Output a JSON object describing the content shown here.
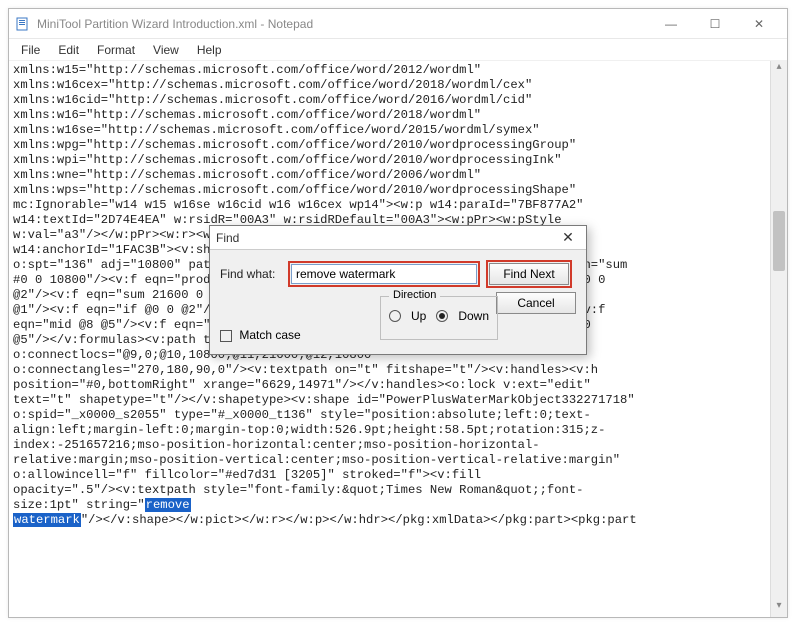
{
  "window": {
    "title": "MiniTool Partition Wizard Introduction.xml - Notepad"
  },
  "menu": {
    "file": "File",
    "edit": "Edit",
    "format": "Format",
    "view": "View",
    "help": "Help"
  },
  "find": {
    "title": "Find",
    "label": "Find what:",
    "value": "remove watermark",
    "find_next": "Find Next",
    "cancel": "Cancel",
    "match_case": "Match case",
    "direction_legend": "Direction",
    "up": "Up",
    "down": "Down",
    "direction_selected": "down"
  },
  "editor": {
    "pre_highlight": "xmlns:w15=\"http://schemas.microsoft.com/office/word/2012/wordml\"\nxmlns:w16cex=\"http://schemas.microsoft.com/office/word/2018/wordml/cex\"\nxmlns:w16cid=\"http://schemas.microsoft.com/office/word/2016/wordml/cid\"\nxmlns:w16=\"http://schemas.microsoft.com/office/word/2018/wordml\"\nxmlns:w16se=\"http://schemas.microsoft.com/office/word/2015/wordml/symex\"\nxmlns:wpg=\"http://schemas.microsoft.com/office/word/2010/wordprocessingGroup\"\nxmlns:wpi=\"http://schemas.microsoft.com/office/word/2010/wordprocessingInk\"\nxmlns:wne=\"http://schemas.microsoft.com/office/word/2006/wordml\"\nxmlns:wps=\"http://schemas.microsoft.com/office/word/2010/wordprocessingShape\"\nmc:Ignorable=\"w14 w15 w16se w16cid w16 w16cex wp14\"><w:p w14:paraId=\"7BF877A2\"\nw14:textId=\"2D74E4EA\" w:rsidR=\"00A3\" w:rsidRDefault=\"00A3\"><w:pPr><w:pStyle\nw:val=\"a3\"/></w:pPr><w:r><w:rPr><w:noProof/></w:rPr><w:pict\nw14:anchorId=\"1FAC3B\"><v:shapetype id=\"_x0000_t136\" coordsize=\"21600, 21600\"\no:spt=\"136\" adj=\"10800\" path=\"m@7,l@8,m@5,21600l@6,21600e\"><v:formulas><v:f eqn=\"sum\n#0 0 10800\"/><v:f eqn=\"prod #0 2 1\"/><v:f eqn=\"sum 21600 0 @1\"/><v:f eqn=\"sum 0 0\n@2\"/><v:f eqn=\"sum 21600 0 @3\"/><v:f eqn=\"if @0 @3 0\"/><v:f eqn=\"if @0 21600\n@1\"/><v:f eqn=\"if @0 0 @2\"/><v:f eqn=\"if @0 @4 21600\"/><v:f eqn=\"mid @5 @6\"/><v:f\neqn=\"mid @8 @5\"/><v:f eqn=\"mid @7 @8\"/><v:f eqn=\"mid @6 @7\"/><v:f eqn=\"sum @6 0\n@5\"/></v:formulas><v:path textpathok=\"t\" o:connecttype=\"custom\"\no:connectlocs=\"@9,0;@10,10800;@11,21600;@12,10800\"\no:connectangles=\"270,180,90,0\"/><v:textpath on=\"t\" fitshape=\"t\"/><v:handles><v:h\nposition=\"#0,bottomRight\" xrange=\"6629,14971\"/></v:handles><o:lock v:ext=\"edit\"\ntext=\"t\" shapetype=\"t\"/></v:shapetype><v:shape id=\"PowerPlusWaterMarkObject332271718\"\no:spid=\"_x0000_s2055\" type=\"#_x0000_t136\" style=\"position:absolute;left:0;text-\nalign:left;margin-left:0;margin-top:0;width:526.9pt;height:58.5pt;rotation:315;z-\nindex:-251657216;mso-position-horizontal:center;mso-position-horizontal-\nrelative:margin;mso-position-vertical:center;mso-position-vertical-relative:margin\"\no:allowincell=\"f\" fillcolor=\"#ed7d31 [3205]\" stroked=\"f\"><v:fill\nopacity=\".5\"/><v:textpath style=\"font-family:&quot;Times New Roman&quot;;font-\nsize:1pt\" string=\"",
    "highlight_1": "remove",
    "mid_text": "\n",
    "highlight_2": "watermark",
    "post_highlight": "\"/></v:shape></w:pict></w:r></w:p></w:hdr></pkg:xmlData></pkg:part><pkg:part"
  }
}
